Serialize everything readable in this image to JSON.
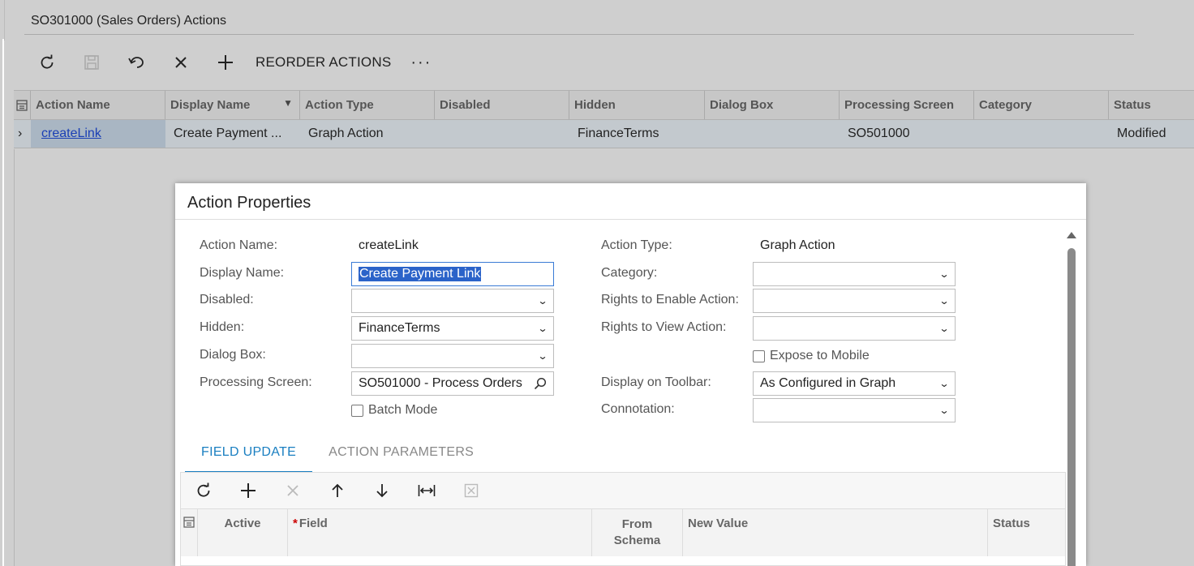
{
  "screen": {
    "title": "SO301000 (Sales Orders) Actions"
  },
  "toolbar": {
    "reorder_label": "REORDER ACTIONS",
    "more_label": "···"
  },
  "grid": {
    "columns": [
      "Action Name",
      "Display Name",
      "Action Type",
      "Disabled",
      "Hidden",
      "Dialog Box",
      "Processing Screen",
      "Category",
      "Status"
    ],
    "row": {
      "action_name": "createLink",
      "display_name": "Create Payment ...",
      "action_type": "Graph Action",
      "disabled": "",
      "hidden": "FinanceTerms",
      "dialog_box": "",
      "processing_screen": "SO501000",
      "category": "",
      "status": "Modified"
    }
  },
  "dialog": {
    "title": "Action Properties",
    "left": {
      "action_name_label": "Action Name:",
      "action_name_value": "createLink",
      "display_name_label": "Display Name:",
      "display_name_value": "Create Payment Link",
      "disabled_label": "Disabled:",
      "disabled_value": "",
      "hidden_label": "Hidden:",
      "hidden_value": "FinanceTerms",
      "dialog_box_label": "Dialog Box:",
      "dialog_box_value": "",
      "processing_screen_label": "Processing Screen:",
      "processing_screen_value": "SO501000 - Process Orders",
      "batch_mode_label": "Batch Mode"
    },
    "right": {
      "action_type_label": "Action Type:",
      "action_type_value": "Graph Action",
      "category_label": "Category:",
      "category_value": "",
      "rights_enable_label": "Rights to Enable Action:",
      "rights_enable_value": "",
      "rights_view_label": "Rights to View Action:",
      "rights_view_value": "",
      "expose_mobile_label": "Expose to Mobile",
      "display_toolbar_label": "Display on Toolbar:",
      "display_toolbar_value": "As Configured in Graph",
      "connotation_label": "Connotation:",
      "connotation_value": ""
    },
    "tabs": [
      {
        "label": "FIELD UPDATE"
      },
      {
        "label": "ACTION PARAMETERS"
      }
    ],
    "subgrid": {
      "col_active": "Active",
      "col_field": "Field",
      "col_field_required": "*",
      "col_from_schema_1": "From",
      "col_from_schema_2": "Schema",
      "col_new_value": "New Value",
      "col_status": "Status"
    }
  }
}
